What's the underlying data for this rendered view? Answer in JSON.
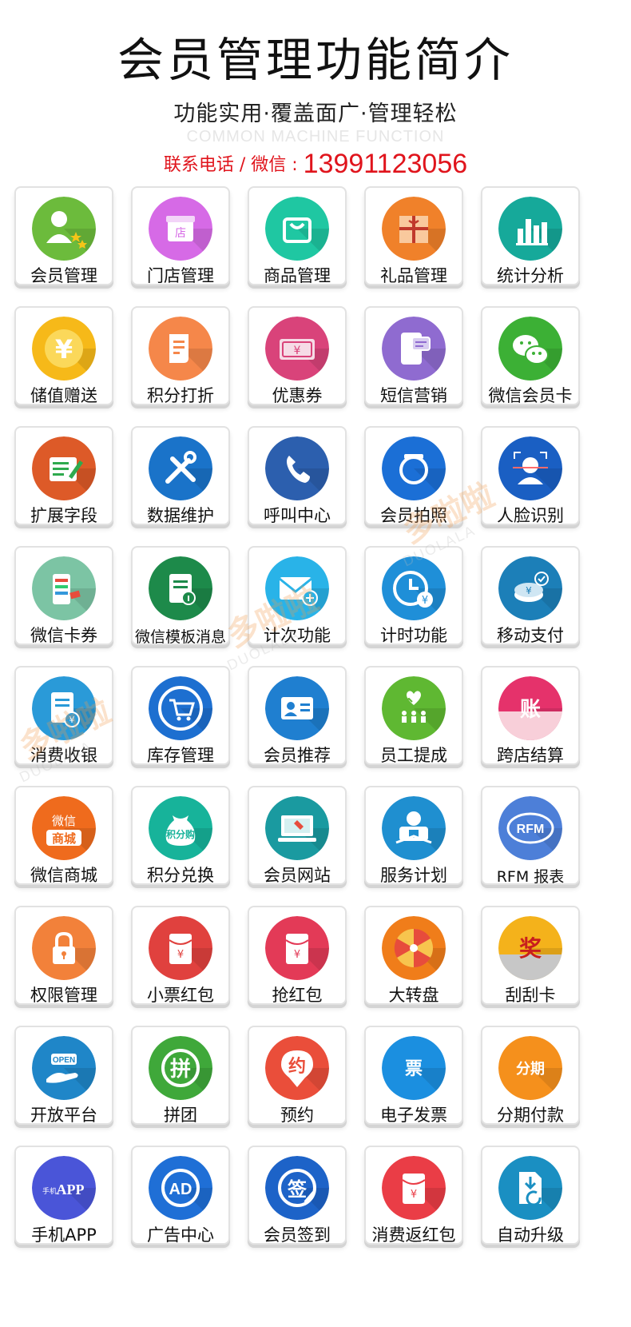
{
  "header": {
    "title": "会员管理功能简介",
    "subtitle": "功能实用·覆盖面广·管理轻松",
    "subtitle_en": "COMMON MACHINE FUNCTION",
    "contact_label": "联系电话 / 微信 : ",
    "contact_number": "13991123056"
  },
  "watermark": {
    "text": "多啦啦",
    "sub": "DUOLALA"
  },
  "features": [
    {
      "label": "会员管理",
      "icon": "member-icon",
      "color": "#6cbb3c"
    },
    {
      "label": "门店管理",
      "icon": "store-icon",
      "color": "#d66ae6"
    },
    {
      "label": "商品管理",
      "icon": "shopping-bag-icon",
      "color": "#1fc7a2"
    },
    {
      "label": "礼品管理",
      "icon": "gift-icon",
      "color": "#f0812a"
    },
    {
      "label": "统计分析",
      "icon": "bar-chart-icon",
      "color": "#16a99a"
    },
    {
      "label": "储值赠送",
      "icon": "yen-coin-icon",
      "color": "#f6b919"
    },
    {
      "label": "积分打折",
      "icon": "document-icon",
      "color": "#f5874a"
    },
    {
      "label": "优惠券",
      "icon": "coupon-icon",
      "color": "#d9437a"
    },
    {
      "label": "短信营销",
      "icon": "sms-icon",
      "color": "#8f6bd0"
    },
    {
      "label": "微信会员卡",
      "icon": "wechat-icon",
      "color": "#3cb035"
    },
    {
      "label": "扩展字段",
      "icon": "edit-icon",
      "color": "#dd5a28"
    },
    {
      "label": "数据维护",
      "icon": "tools-icon",
      "color": "#1a73c9"
    },
    {
      "label": "呼叫中心",
      "icon": "phone-icon",
      "color": "#2c5fae"
    },
    {
      "label": "会员拍照",
      "icon": "camera-icon",
      "color": "#1b6fd6"
    },
    {
      "label": "人脸识别",
      "icon": "face-scan-icon",
      "color": "#1a5fc3"
    },
    {
      "label": "微信卡券",
      "icon": "card-voucher-icon",
      "color": "#7cc4a4"
    },
    {
      "label": "微信模板消息",
      "icon": "template-message-icon",
      "color": "#1d8a4a"
    },
    {
      "label": "计次功能",
      "icon": "envelope-plus-icon",
      "color": "#29b3e8"
    },
    {
      "label": "计时功能",
      "icon": "clock-yen-icon",
      "color": "#1f8fd8"
    },
    {
      "label": "移动支付",
      "icon": "mobile-pay-icon",
      "color": "#1c7fb8"
    },
    {
      "label": "消费收银",
      "icon": "receipt-icon",
      "color": "#2a9ad8"
    },
    {
      "label": "库存管理",
      "icon": "cart-icon",
      "color": "#1d6fd0"
    },
    {
      "label": "会员推荐",
      "icon": "id-card-icon",
      "color": "#1f7fd0"
    },
    {
      "label": "员工提成",
      "icon": "team-icon",
      "color": "#5fb832"
    },
    {
      "label": "跨店结算",
      "icon": "account-icon",
      "color": "#e5326b"
    },
    {
      "label": "微信商城",
      "icon": "wechat-mall-icon",
      "color": "#ef6b1d"
    },
    {
      "label": "积分兑换",
      "icon": "points-bag-icon",
      "color": "#17b39a"
    },
    {
      "label": "会员网站",
      "icon": "website-icon",
      "color": "#1a9aa0"
    },
    {
      "label": "服务计划",
      "icon": "service-plan-icon",
      "color": "#1f8fd0"
    },
    {
      "label": "RFM 报表",
      "icon": "rfm-icon",
      "color": "#4d7fd8"
    },
    {
      "label": "权限管理",
      "icon": "lock-icon",
      "color": "#f2813a"
    },
    {
      "label": "小票红包",
      "icon": "red-envelope-icon",
      "color": "#e0413e"
    },
    {
      "label": "抢红包",
      "icon": "grab-red-envelope-icon",
      "color": "#e33a57"
    },
    {
      "label": "大转盘",
      "icon": "lucky-wheel-icon",
      "color": "#f07d1a"
    },
    {
      "label": "刮刮卡",
      "icon": "scratch-card-icon",
      "color": "#f4b21b"
    },
    {
      "label": "开放平台",
      "icon": "open-platform-icon",
      "color": "#1f86c8"
    },
    {
      "label": "拼团",
      "icon": "group-buy-icon",
      "color": "#3fa83a"
    },
    {
      "label": "预约",
      "icon": "appointment-icon",
      "color": "#ea4e3a"
    },
    {
      "label": "电子发票",
      "icon": "invoice-icon",
      "color": "#1b8fe0"
    },
    {
      "label": "分期付款",
      "icon": "installment-icon",
      "color": "#f5901c"
    },
    {
      "label": "手机APP",
      "icon": "mobile-app-icon",
      "color": "#4a55d8"
    },
    {
      "label": "广告中心",
      "icon": "ad-center-icon",
      "color": "#1f6fd6"
    },
    {
      "label": "会员签到",
      "icon": "sign-in-icon",
      "color": "#1d63c8"
    },
    {
      "label": "消费返红包",
      "icon": "cashback-envelope-icon",
      "color": "#ea3d46"
    },
    {
      "label": "自动升级",
      "icon": "auto-upgrade-icon",
      "color": "#1a8fc2"
    }
  ],
  "icon_text": {
    "store": "店",
    "yen": "¥",
    "wechat_mall_top": "微信",
    "wechat_mall_bottom": "商城",
    "points_bag": "积分购",
    "rfm": "RFM",
    "scratch": "奖",
    "open": "OPEN",
    "group_buy": "拼",
    "appointment": "约",
    "invoice": "票",
    "installment": "分期",
    "app_small": "手机",
    "app_big": "APP",
    "ad": "AD",
    "sign": "签",
    "account": "账"
  }
}
